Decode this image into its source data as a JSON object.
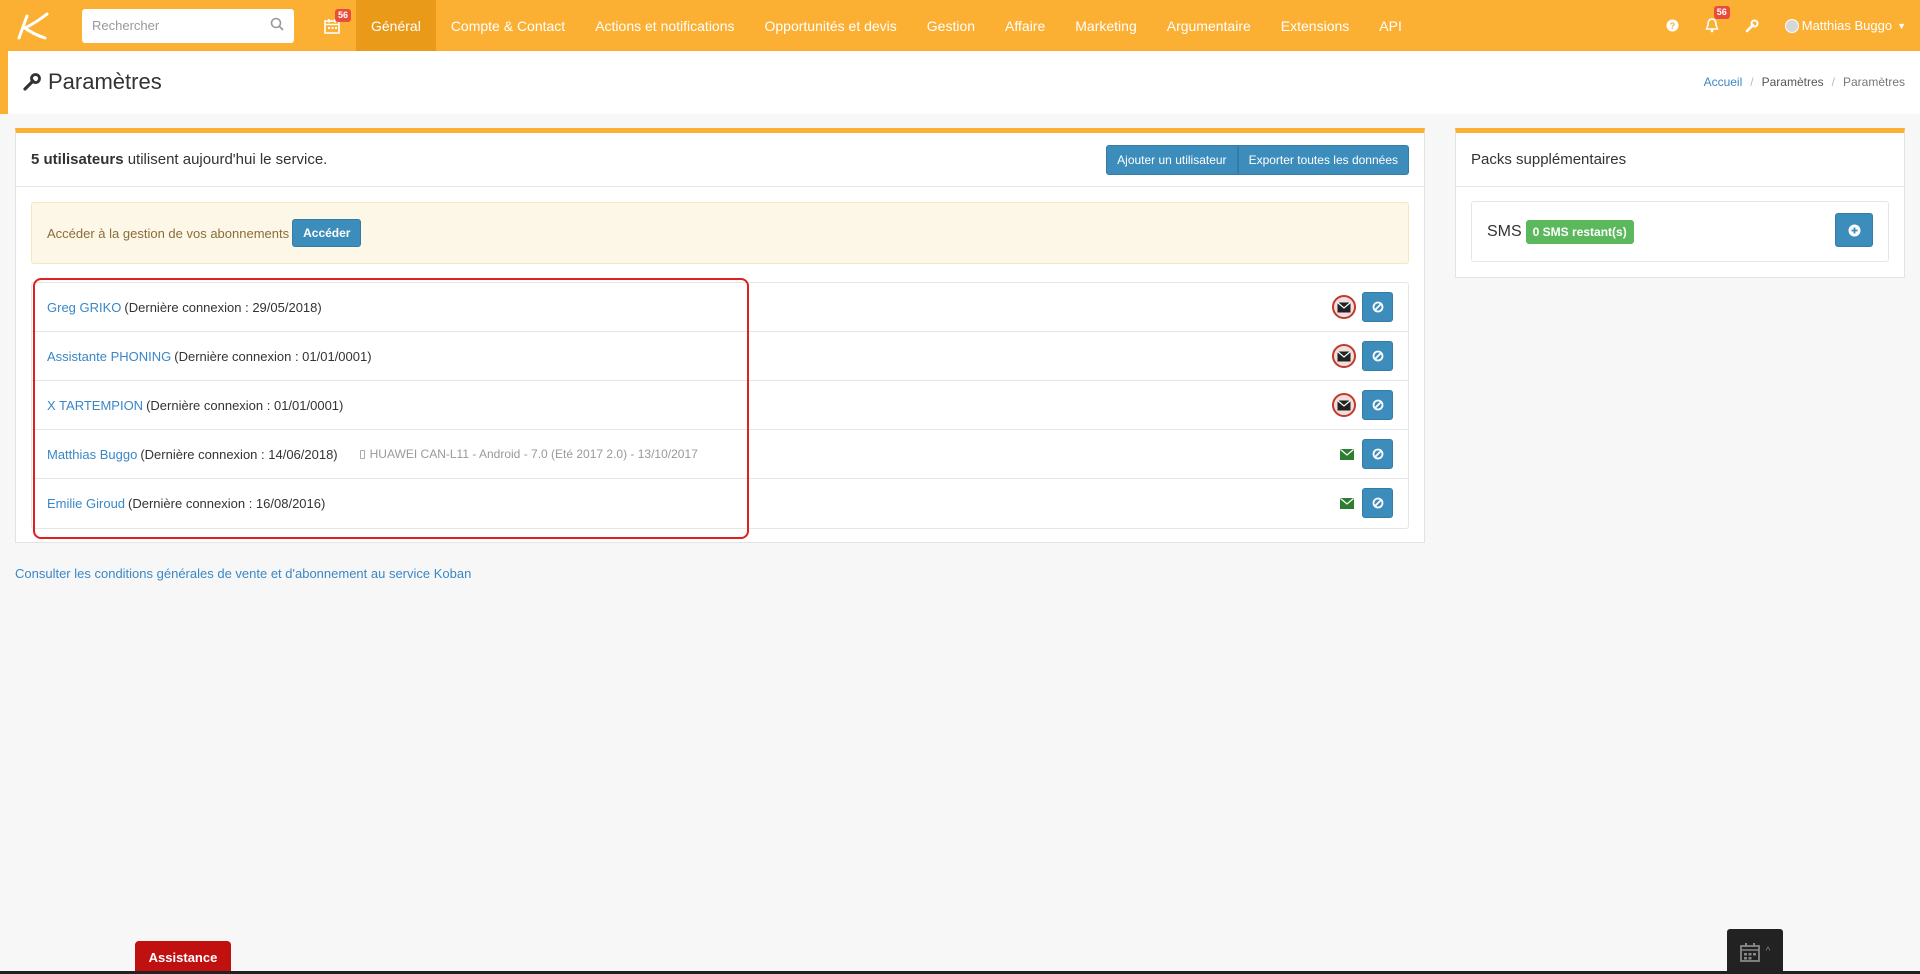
{
  "topbar": {
    "search_placeholder": "Rechercher",
    "calendar_badge": "56",
    "notif_badge": "56",
    "nav": [
      {
        "label": "Général",
        "active": true
      },
      {
        "label": "Compte & Contact"
      },
      {
        "label": "Actions et notifications"
      },
      {
        "label": "Opportunités et devis"
      },
      {
        "label": "Gestion"
      },
      {
        "label": "Affaire"
      },
      {
        "label": "Marketing"
      },
      {
        "label": "Argumentaire"
      },
      {
        "label": "Extensions"
      },
      {
        "label": "API"
      }
    ],
    "user_name": "Matthias Buggo"
  },
  "header": {
    "title": "Paramètres",
    "breadcrumb": [
      "Accueil",
      "Paramètres",
      "Paramètres"
    ]
  },
  "main": {
    "users_count": "5 utilisateurs",
    "users_text": " utilisent aujourd'hui le service.",
    "add_user_label": "Ajouter un utilisateur",
    "export_label": "Exporter toutes les données",
    "alert_text": "Accéder à la gestion de vos abonnements",
    "alert_button": "Accéder",
    "users": [
      {
        "name": "Greg GRIKO",
        "connection": "(Dernière connexion : 29/05/2018)",
        "device": "",
        "mail_enabled": false
      },
      {
        "name": "Assistante PHONING",
        "connection": "(Dernière connexion : 01/01/0001)",
        "device": "",
        "mail_enabled": false
      },
      {
        "name": "X TARTEMPION",
        "connection": "(Dernière connexion : 01/01/0001)",
        "device": "",
        "mail_enabled": false
      },
      {
        "name": "Matthias Buggo",
        "connection": "(Dernière connexion : 14/06/2018)",
        "device": "HUAWEI CAN-L11 - Android - 7.0 (Eté 2017 2.0) - 13/10/2017",
        "mail_enabled": true
      },
      {
        "name": "Emilie Giroud",
        "connection": "(Dernière connexion : 16/08/2016)",
        "device": "",
        "mail_enabled": true
      }
    ],
    "cgv_link": "Consulter les conditions générales de vente et d'abonnement au service Koban"
  },
  "side": {
    "title": "Packs supplémentaires",
    "sms_label": "SMS",
    "sms_badge": "0 SMS restant(s)"
  },
  "footer": {
    "assistance_label": "Assistance"
  },
  "colors": {
    "brand": "#fbb034",
    "brand_active": "#e99a18",
    "primary": "#3c8dbc",
    "link": "#3a87c8",
    "danger": "#c0100f",
    "success": "#5cb85c"
  }
}
